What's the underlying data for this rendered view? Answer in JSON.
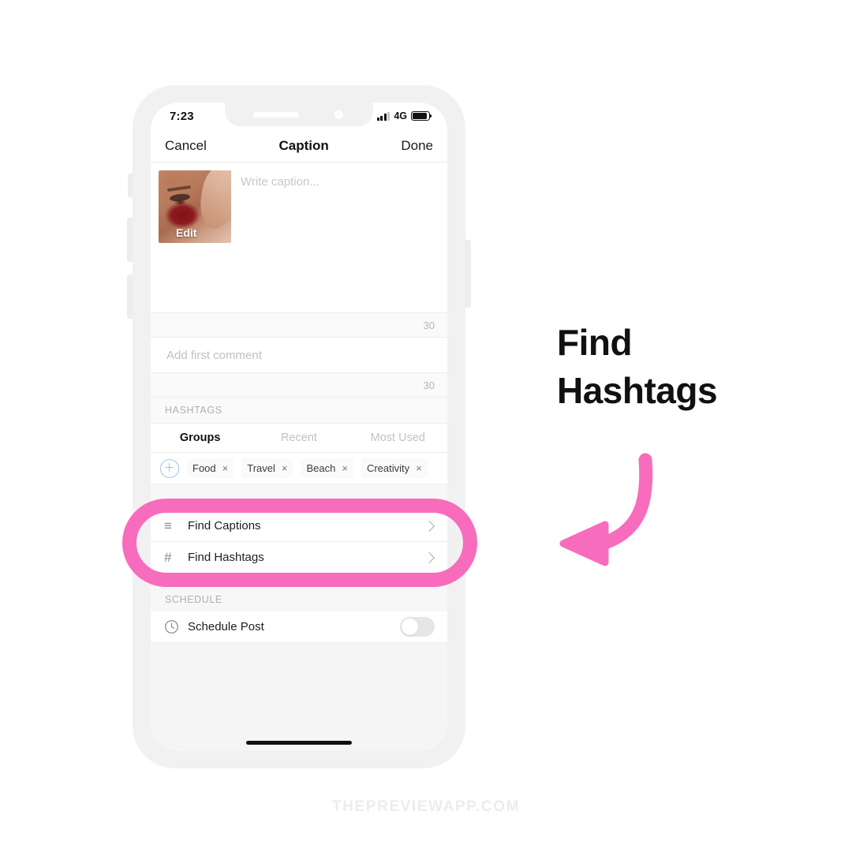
{
  "canvas": {
    "background": "#ffffff",
    "watermark": "THEPREVIEWAPP.COM"
  },
  "annotation": {
    "heading_line1": "Find",
    "heading_line2": "Hashtags",
    "highlight_color": "#f76cbd",
    "arrow_color": "#f76cbd",
    "heading_color": "#111111"
  },
  "phone": {
    "status_bar": {
      "time": "7:23",
      "network": "4G",
      "signal_icon": "signal-bars-icon",
      "battery_icon": "battery-icon"
    },
    "nav_bar": {
      "cancel_label": "Cancel",
      "title": "Caption",
      "done_label": "Done"
    },
    "caption": {
      "placeholder": "Write caption...",
      "edit_label": "Edit",
      "char_counter": "30"
    },
    "comment": {
      "placeholder": "Add first comment",
      "char_counter": "30"
    },
    "hashtags": {
      "section_label": "HASHTAGS",
      "tabs": [
        {
          "label": "Groups",
          "active": true
        },
        {
          "label": "Recent",
          "active": false
        },
        {
          "label": "Most Used",
          "active": false
        }
      ],
      "add_icon": "plus-circle-icon",
      "chips": [
        {
          "label": "Food",
          "remove_icon": "close-icon"
        },
        {
          "label": "Travel",
          "remove_icon": "close-icon"
        },
        {
          "label": "Beach",
          "remove_icon": "close-icon"
        },
        {
          "label": "Creativity",
          "remove_icon": "close-icon"
        }
      ]
    },
    "tools": {
      "rows": [
        {
          "icon": "list-lines-icon",
          "glyph": "≡",
          "label": "Find Captions",
          "chevron": "chevron-right-icon"
        },
        {
          "icon": "hash-icon",
          "glyph": "#",
          "label": "Find Hashtags",
          "chevron": "chevron-right-icon"
        }
      ]
    },
    "schedule": {
      "section_label": "SCHEDULE",
      "row_icon": "clock-icon",
      "row_label": "Schedule Post",
      "toggle_state": "off"
    },
    "home_indicator": "home-indicator"
  }
}
